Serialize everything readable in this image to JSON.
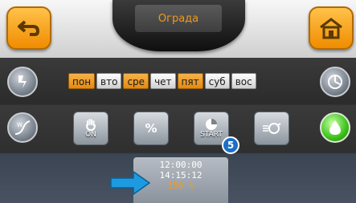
{
  "header": {
    "title": "Ограда"
  },
  "days": [
    {
      "label": "пон",
      "active": true
    },
    {
      "label": "вто",
      "active": false
    },
    {
      "label": "сре",
      "active": true
    },
    {
      "label": "чет",
      "active": false
    },
    {
      "label": "пят",
      "active": true
    },
    {
      "label": "суб",
      "active": false
    },
    {
      "label": "вос",
      "active": false
    }
  ],
  "buttons": {
    "manual_label": "ON",
    "percent_label": "%",
    "start_label": "START"
  },
  "badge": "5",
  "info": {
    "time1": "12:00:00",
    "time2": "14:15:12",
    "percent": "150 %"
  },
  "colors": {
    "accent": "#f29a1c",
    "badge": "#1c6fc6",
    "arrow": "#1e9be0"
  }
}
